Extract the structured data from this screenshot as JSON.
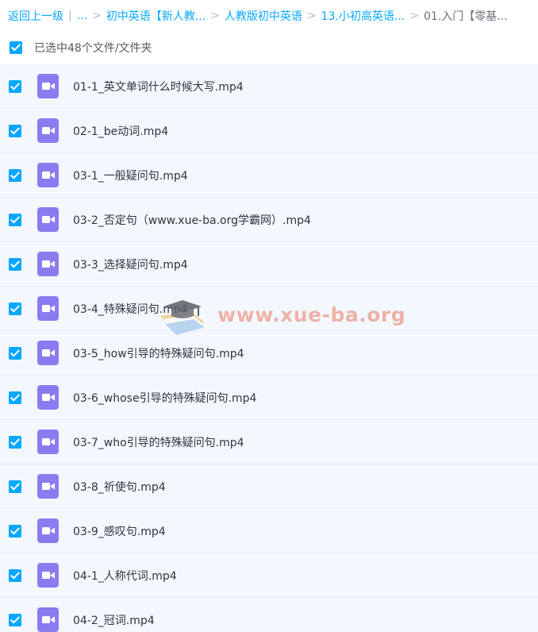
{
  "breadcrumb": {
    "back_label": "返回上一级",
    "divider": "|",
    "ellipsis": "...",
    "sep": ">",
    "items": [
      "初中英语【新人教...",
      "人教版初中英语",
      "13.小初高英语..."
    ],
    "current": "01.入门【零基..."
  },
  "selection": {
    "label": "已选中48个文件/文件夹"
  },
  "files": [
    {
      "name": "01-1_英文单词什么时候大写.mp4"
    },
    {
      "name": "02-1_be动词.mp4"
    },
    {
      "name": "03-1_一般疑问句.mp4"
    },
    {
      "name": "03-2_否定句（www.xue-ba.org学霸网）.mp4"
    },
    {
      "name": "03-3_选择疑问句.mp4"
    },
    {
      "name": "03-4_特殊疑问句.mp4"
    },
    {
      "name": "03-5_how引导的特殊疑问句.mp4"
    },
    {
      "name": "03-6_whose引导的特殊疑问句.mp4"
    },
    {
      "name": "03-7_who引导的特殊疑问句.mp4"
    },
    {
      "name": "03-8_祈使句.mp4"
    },
    {
      "name": "03-9_感叹句.mp4"
    },
    {
      "name": "04-1_人称代词.mp4"
    },
    {
      "name": "04-2_冠词.mp4"
    }
  ],
  "watermark": {
    "text": "www.xue-ba.org"
  },
  "colors": {
    "accent": "#06a7ff",
    "video_icon": "#8a7cf0",
    "row_bg": "#f3f8fe",
    "watermark": "#e9785f"
  }
}
